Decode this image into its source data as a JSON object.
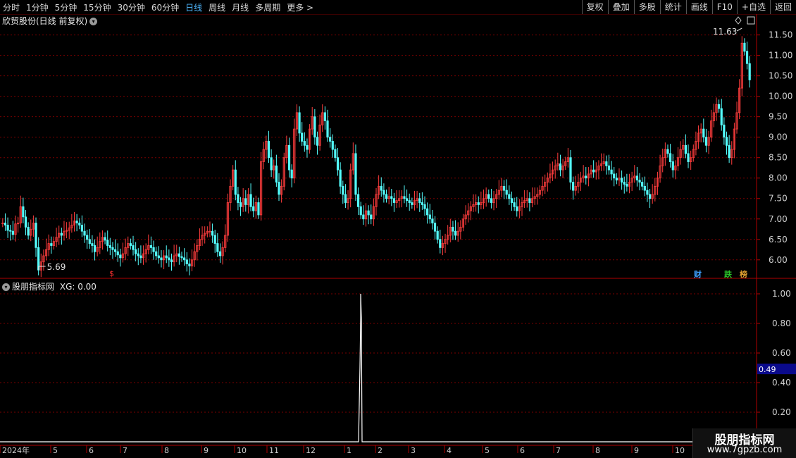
{
  "toolbar": {
    "periods": [
      {
        "label": "分时",
        "active": false
      },
      {
        "label": "1分钟",
        "active": false
      },
      {
        "label": "5分钟",
        "active": false
      },
      {
        "label": "15分钟",
        "active": false
      },
      {
        "label": "30分钟",
        "active": false
      },
      {
        "label": "60分钟",
        "active": false
      },
      {
        "label": "日线",
        "active": true
      },
      {
        "label": "周线",
        "active": false
      },
      {
        "label": "月线",
        "active": false
      },
      {
        "label": "多周期",
        "active": false
      },
      {
        "label": "更多 >",
        "active": false
      }
    ],
    "actions": [
      "复权",
      "叠加",
      "多股",
      "统计",
      "画线",
      "F10",
      "+自选",
      "返回"
    ]
  },
  "main_chart": {
    "title": "欣贸股份(日线 前复权)",
    "high_label": "11.63",
    "low_label": "5.69",
    "y_ticks": [
      "11.50",
      "11.00",
      "10.50",
      "10.00",
      "9.50",
      "9.00",
      "8.50",
      "8.00",
      "7.50",
      "7.00",
      "6.50",
      "6.00"
    ],
    "badges": [
      {
        "text": "财",
        "color": "#3ea0ff"
      },
      {
        "text": "跌",
        "color": "#29c229"
      },
      {
        "text": "榜",
        "color": "#e0a030"
      }
    ],
    "marker": "$"
  },
  "sub_chart": {
    "title": "股朋指标网",
    "indicator": "XG: 0.00",
    "y_ticks": [
      "1.00",
      "0.80",
      "0.60",
      "0.40",
      "0.20"
    ],
    "cursor_value": "0.49"
  },
  "x_axis": {
    "labels": [
      "2024年",
      "5",
      "6",
      "7",
      "8",
      "9",
      "10",
      "11",
      "12",
      "1",
      "2",
      "3",
      "4",
      "5",
      "6",
      "7",
      "8",
      "9",
      "10"
    ]
  },
  "logo": {
    "line1": "股朋指标网",
    "line2": "www.7gpzb.com"
  },
  "colors": {
    "up": "#ff3d3d",
    "down": "#54ffff",
    "grid": "#7a0000",
    "axis": "#b00000",
    "active": "#4fb8ff"
  },
  "chart_data": {
    "type": "candlestick",
    "ylim": [
      5.6,
      11.7
    ],
    "close": [
      6.9,
      6.85,
      6.72,
      6.7,
      6.62,
      6.88,
      6.9,
      7.3,
      7.05,
      6.8,
      6.6,
      6.75,
      6.9,
      6.3,
      5.75,
      5.95,
      6.1,
      6.25,
      6.4,
      6.35,
      6.45,
      6.55,
      6.65,
      6.6,
      6.7,
      6.72,
      6.78,
      6.85,
      6.95,
      6.9,
      6.85,
      6.7,
      6.6,
      6.5,
      6.4,
      6.35,
      6.2,
      6.3,
      6.45,
      6.55,
      6.48,
      6.35,
      6.3,
      6.25,
      6.2,
      6.12,
      6.05,
      6.15,
      6.3,
      6.4,
      6.35,
      6.25,
      6.15,
      6.1,
      6.05,
      6.15,
      6.25,
      6.35,
      6.3,
      6.2,
      6.1,
      6.05,
      6.0,
      6.1,
      6.05,
      6.0,
      5.95,
      6.1,
      6.15,
      6.08,
      6.05,
      6.0,
      5.9,
      5.85,
      6.0,
      6.2,
      6.35,
      6.5,
      6.6,
      6.65,
      6.7,
      6.7,
      6.6,
      6.4,
      6.2,
      6.1,
      6.3,
      6.6,
      7.4,
      7.8,
      8.2,
      7.6,
      7.4,
      7.3,
      7.5,
      7.35,
      7.6,
      7.3,
      7.2,
      7.4,
      7.1,
      8.4,
      8.7,
      8.9,
      8.5,
      8.2,
      8.3,
      7.9,
      7.6,
      7.8,
      8.5,
      8.8,
      8.2,
      8.0,
      9.2,
      9.6,
      9.1,
      8.9,
      8.8,
      8.7,
      9.2,
      9.5,
      9.0,
      8.8,
      9.3,
      9.6,
      9.4,
      9.0,
      8.9,
      8.7,
      8.5,
      8.2,
      7.8,
      7.6,
      7.4,
      7.5,
      8.2,
      8.6,
      7.6,
      7.3,
      7.1,
      7.0,
      7.2,
      7.1,
      7.0,
      7.3,
      7.6,
      7.8,
      7.7,
      7.6,
      7.5,
      7.55,
      7.5,
      7.4,
      7.45,
      7.5,
      7.55,
      7.5,
      7.45,
      7.4,
      7.35,
      7.45,
      7.5,
      7.4,
      7.35,
      7.25,
      7.1,
      7.0,
      6.9,
      6.7,
      6.5,
      6.3,
      6.4,
      6.5,
      6.6,
      6.8,
      6.7,
      6.6,
      6.7,
      6.8,
      7.0,
      7.1,
      7.2,
      7.3,
      7.35,
      7.4,
      7.35,
      7.4,
      7.5,
      7.6,
      7.5,
      7.4,
      7.5,
      7.6,
      7.7,
      7.8,
      7.7,
      7.6,
      7.5,
      7.4,
      7.3,
      7.2,
      7.3,
      7.4,
      7.45,
      7.5,
      7.4,
      7.5,
      7.55,
      7.6,
      7.7,
      7.8,
      7.9,
      8.0,
      8.1,
      8.2,
      8.3,
      8.35,
      8.2,
      8.3,
      8.4,
      8.5,
      7.9,
      7.7,
      7.8,
      7.9,
      8.0,
      8.05,
      8.0,
      8.1,
      8.2,
      8.15,
      8.2,
      8.3,
      8.35,
      8.4,
      8.3,
      8.2,
      8.1,
      8.0,
      7.95,
      8.0,
      7.9,
      7.85,
      7.8,
      7.9,
      8.0,
      8.05,
      7.95,
      7.9,
      7.8,
      7.7,
      7.6,
      7.5,
      7.6,
      7.8,
      8.0,
      8.3,
      8.5,
      8.7,
      8.6,
      8.4,
      8.2,
      8.3,
      8.5,
      8.7,
      8.8,
      8.6,
      8.4,
      8.5,
      8.7,
      8.9,
      9.1,
      9.2,
      9.0,
      8.8,
      9.0,
      9.4,
      9.6,
      9.8,
      9.7,
      9.3,
      9.0,
      8.8,
      8.5,
      8.7,
      9.2,
      9.6,
      10.2,
      11.3,
      11.1,
      10.8,
      10.4
    ],
    "xg": {
      "values": [
        0.0,
        1.0,
        0.0
      ],
      "note": "single spike"
    }
  }
}
